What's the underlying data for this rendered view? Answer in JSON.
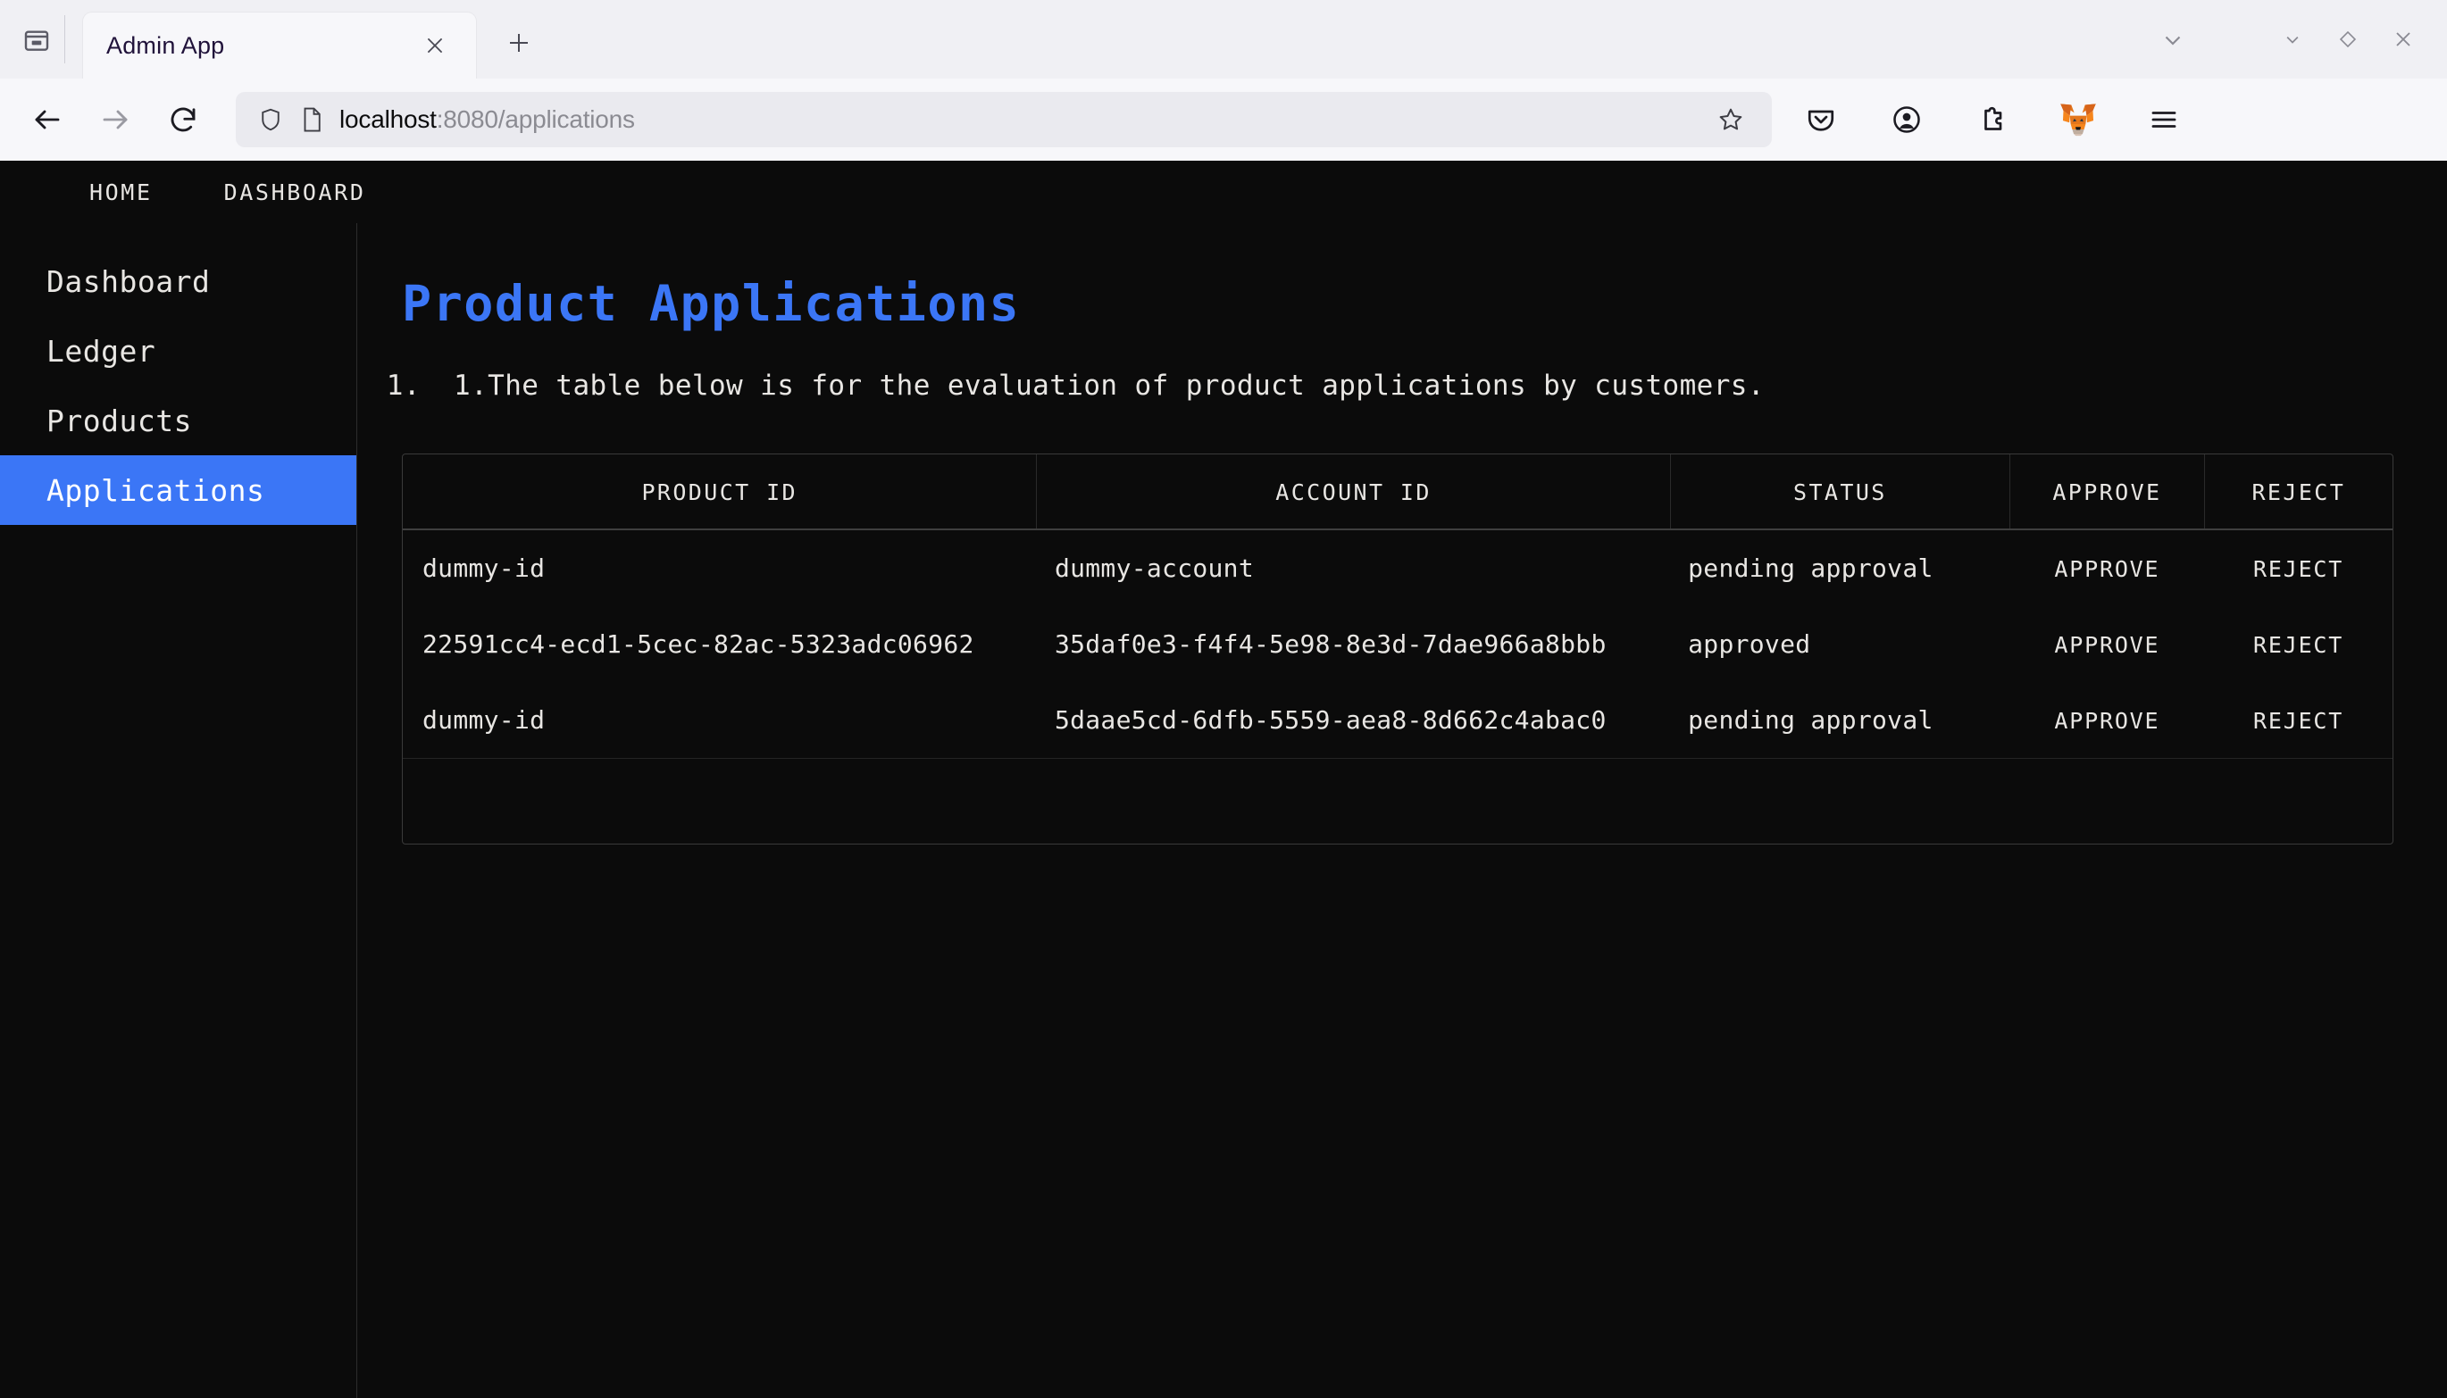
{
  "browser": {
    "tab": {
      "title": "Admin App",
      "close_label": "✕"
    },
    "tab_list_icon": "tab-list-icon",
    "new_tab_label": "+",
    "window_controls": {
      "minimize": "⌄",
      "restore": "◇",
      "close": "✕",
      "extra_chevron": "⌄"
    },
    "nav": {
      "back_label": "←",
      "forward_label": "→",
      "reload_label": "⟳",
      "url_host": "localhost",
      "url_rest": ":8080/applications",
      "url_full": "localhost:8080/applications",
      "bookmark_label": "☆",
      "toolbar_icons": [
        "pocket-icon",
        "account-icon",
        "extensions-icon",
        "metamask-icon",
        "app-menu-icon"
      ],
      "metamask_color": "#e2761b"
    }
  },
  "topnav": {
    "items": [
      {
        "label": "HOME"
      },
      {
        "label": "DASHBOARD"
      }
    ]
  },
  "sidebar": {
    "active_color": "#3b76f6",
    "items": [
      {
        "label": "Dashboard",
        "active": false
      },
      {
        "label": "Ledger",
        "active": false
      },
      {
        "label": "Products",
        "active": false
      },
      {
        "label": "Applications",
        "active": true
      }
    ]
  },
  "main": {
    "title": "Product Applications",
    "title_color": "#3b76f6",
    "description_items": [
      "1.The table below is for the evaluation of product applications by customers."
    ],
    "table": {
      "columns": [
        "PRODUCT ID",
        "ACCOUNT ID",
        "STATUS",
        "APPROVE",
        "REJECT"
      ],
      "rows": [
        {
          "product_id": "dummy-id",
          "account_id": "dummy-account",
          "status": "pending approval",
          "approve": "APPROVE",
          "reject": "REJECT"
        },
        {
          "product_id": "22591cc4-ecd1-5cec-82ac-5323adc06962",
          "account_id": "35daf0e3-f4f4-5e98-8e3d-7dae966a8bbb",
          "status": "approved",
          "approve": "APPROVE",
          "reject": "REJECT"
        },
        {
          "product_id": "dummy-id",
          "account_id": "5daae5cd-6dfb-5559-aea8-8d662c4abac0",
          "status": "pending approval",
          "approve": "APPROVE",
          "reject": "REJECT"
        }
      ]
    }
  }
}
